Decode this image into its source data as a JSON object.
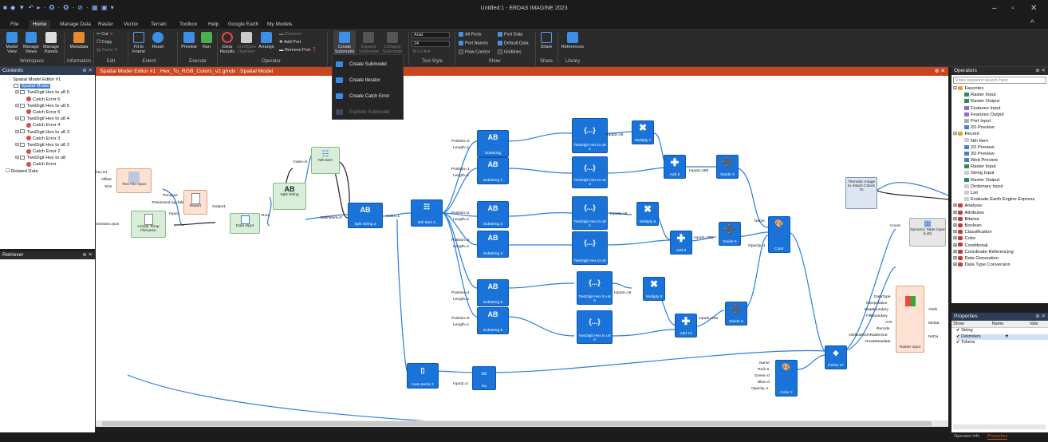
{
  "app": {
    "title": "Untitled:1 - ERDAS IMAGINE 2023"
  },
  "menu": [
    "File",
    "Home",
    "Manage Data",
    "Raster",
    "Vector",
    "Terrain",
    "Toolbox",
    "Help",
    "Google Earth",
    "My Models"
  ],
  "ribbon": {
    "workspace": {
      "buttons": [
        "Model View",
        "Manage Views",
        "Manage Panels"
      ],
      "group": "Workspace"
    },
    "information": {
      "buttons": [
        "Metadata"
      ],
      "group": "Information"
    },
    "edit": {
      "items": [
        "Cut",
        "Copy",
        "Paste"
      ],
      "group": "Edit"
    },
    "extent": {
      "buttons": [
        "Fit to Frame",
        "Reset"
      ],
      "group": "Extent"
    },
    "execute": {
      "buttons": [
        "Preview",
        "Run"
      ],
      "group": "Execute"
    },
    "operator": {
      "buttons": [
        "Clear Results",
        "Configure Operator",
        "Arrange"
      ],
      "items": [
        "Remove",
        "Add Port",
        "Remove Port"
      ],
      "group": "Operator"
    },
    "submodel": {
      "buttons": [
        "Create Submodel",
        "Expand Submodel",
        "Collapse Submodel"
      ]
    },
    "textstyle": {
      "font": "Arial",
      "size": "24",
      "group": "Text Style"
    },
    "show": {
      "items": [
        {
          "label": "All Ports",
          "on": true
        },
        {
          "label": "Port Names",
          "on": true
        },
        {
          "label": "Flow Control",
          "on": false
        },
        {
          "label": "Port Data",
          "on": true
        },
        {
          "label": "Default Data",
          "on": true
        },
        {
          "label": "Gridlines",
          "on": false
        }
      ],
      "group": "Show"
    },
    "share": {
      "buttons": [
        "Share"
      ],
      "group": "Share"
    },
    "library": {
      "buttons": [
        "References"
      ],
      "group": "Library"
    }
  },
  "dropdown": {
    "items": [
      "Create Submodel",
      "Create Iterator",
      "Create Catch Error",
      "Explode Submodel"
    ]
  },
  "contents": {
    "title": "Contents",
    "tree": [
      "Spatial Model Editor #1",
      "Spatial Model",
      "TwoDigit Hex to u8 6",
      "Catch Error 6",
      "TwoDigit Hex to u8 5",
      "Catch Error 5",
      "TwoDigit Hex to u8 4",
      "Catch Error 4",
      "TwoDigit Hex to u8 3",
      "Catch Error 3",
      "TwoDigit Hex to u8 2",
      "Catch Error 2",
      "TwoDigit Hex to u8",
      "Catch Error",
      "Related Data"
    ]
  },
  "retriever": {
    "title": "Retriever"
  },
  "editor": {
    "title": "Spatial Model Editor #1 : Hex_To_RGB_Colors_v2.gmdx : Spatial Model"
  },
  "nodes": {
    "text_file_input": "Text File Input",
    "create_temp": "Create Temp Filename",
    "report": "Report",
    "data_input": "Data Input",
    "split_string": "Split String",
    "nth_item": "Nth Item",
    "split_string_2": "Split String 2",
    "nth_item_2": "Nth Item 2",
    "substring": [
      "Substring",
      "Substring 2",
      "Substring 3",
      "Substring 4",
      "Substring 5",
      "Substring 6"
    ],
    "hex": [
      "TwoDigit Hex to u8 2",
      "TwoDigit Hex to u8 3",
      "TwoDigit Hex to u8 4",
      "TwoDigit Hex to u8",
      "TwoDigit Hex to u8 5",
      "TwoDigit Hex to u8 6"
    ],
    "multiply": [
      "Multiply 7",
      "Multiply 8",
      "Multiply 9"
    ],
    "add": [
      "Add 8",
      "Add 9",
      "Add 10"
    ],
    "divide": [
      "Divide 3",
      "Divide 5",
      "Divide 6"
    ],
    "color": "Color",
    "color_2": "Color 2",
    "num_items": "Num Items 3",
    "eq": "Eq",
    "ifelse": "If Else 47",
    "dynamic_table": "Dynamic Table Input (List)",
    "raster_input": "Raster Input",
    "thematic": "Thematic Image to Attach Colors To"
  },
  "ports": {
    "hex_txt": "hex.txt",
    "offset": "Offset",
    "size": "Size",
    "ext_json": "xtension=json",
    "previous": "Previous",
    "to_session": "ToSessionLog=false",
    "input1": "Input1",
    "output1": "Output1",
    "root": "Root",
    "index0": "Index=0",
    "delimiters": "Delimiters=#",
    "index1": "Index=1",
    "substr": [
      [
        "Position=0",
        "Length=1"
      ],
      [
        "Position=1",
        "Length=1"
      ],
      [
        "Position=2",
        "Length=1"
      ],
      [
        "Position=3",
        "Length=1"
      ],
      [
        "Position=4",
        "Length=1"
      ],
      [
        "Position=5",
        "Length=1"
      ]
    ],
    "input2_16": "Input2=16",
    "input2_255": "Input2=255",
    "input2_2": "Input2=2",
    "name": "Name",
    "opacity": "Opacity=1",
    "count": "Count",
    "color2": [
      "Name",
      "Red=0",
      "Green=0",
      "Blue=0",
      "Opacity=1"
    ],
    "raster": [
      "DataType",
      "Interpolation",
      "MapBoundary",
      "FillBoundary",
      "AOI",
      "Recode",
      "AttributesOnRasterOut",
      "ReadMetadata"
    ],
    "raster_out": [
      "Attrib",
      "Metad",
      "NoDa"
    ]
  },
  "operators": {
    "title": "Operators",
    "search_placeholder": "Enter keyword search here",
    "favorites": "Favorites",
    "fav_items": [
      "Raster Input",
      "Raster Output",
      "Features Input",
      "Features Output",
      "Port Input",
      "2D Preview"
    ],
    "recent": "Recent",
    "recent_items": [
      "Nth Item",
      "2D Preview",
      "3D Preview",
      "Web Preview",
      "Raster Input",
      "String Input",
      "Raster Output",
      "Dictionary Input",
      "List",
      "Evaluate Earth Engine Express"
    ],
    "categories": [
      "Analysis",
      "Attributes",
      "Bitwise",
      "Boolean",
      "Classification",
      "Color",
      "Conditional",
      "Coordinate Referencing",
      "Data Generation",
      "Data Type Conversion"
    ]
  },
  "properties": {
    "title": "Properties",
    "cols": [
      "Show",
      "Name",
      "Valu"
    ],
    "rows": [
      "String",
      "Delimiters",
      "Tokens"
    ]
  },
  "status": {
    "tabs": [
      "Operator Info",
      "Properties"
    ]
  }
}
